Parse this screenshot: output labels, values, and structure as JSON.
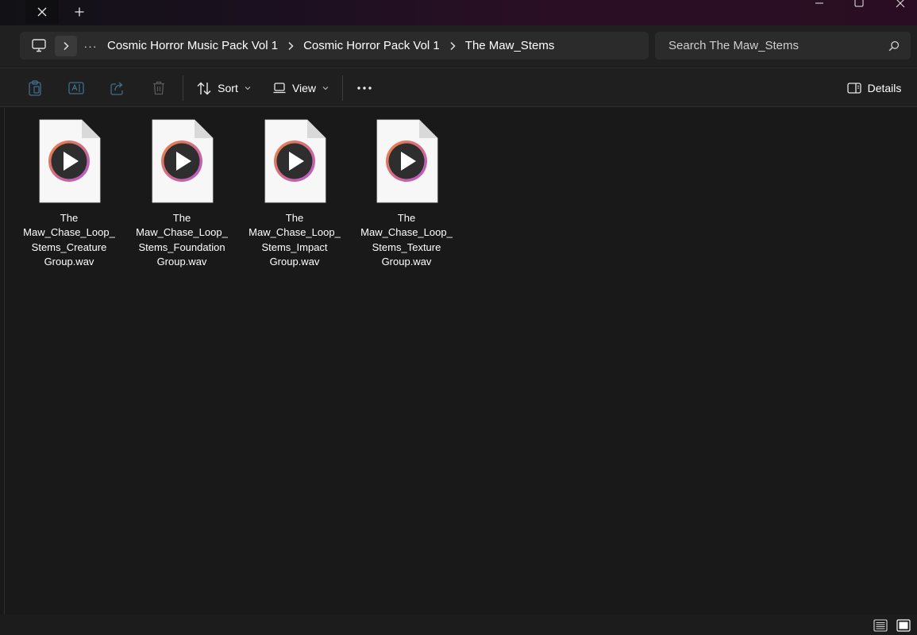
{
  "window": {
    "tab_close_glyph": "✕",
    "new_tab_glyph": "+"
  },
  "breadcrumb": {
    "more_glyph": "···",
    "items": [
      {
        "label": "Cosmic Horror Music Pack Vol 1"
      },
      {
        "label": "Cosmic Horror Pack Vol 1"
      },
      {
        "label": "The Maw_Stems"
      }
    ]
  },
  "search": {
    "placeholder": "Search The Maw_Stems"
  },
  "toolbar": {
    "sort_label": "Sort",
    "view_label": "View",
    "details_label": "Details"
  },
  "files": [
    {
      "name_lines": [
        "The",
        "Maw_Chase_Loop_",
        "Stems_Creature",
        "Group.wav"
      ]
    },
    {
      "name_lines": [
        "The",
        "Maw_Chase_Loop_",
        "Stems_Foundation",
        "Group.wav"
      ]
    },
    {
      "name_lines": [
        "The",
        "Maw_Chase_Loop_",
        "Stems_Impact",
        "Group.wav"
      ]
    },
    {
      "name_lines": [
        "The",
        "Maw_Chase_Loop_",
        "Stems_Texture",
        "Group.wav"
      ]
    }
  ],
  "icons": {
    "file": "media-player-audio-file-icon",
    "toolbar": [
      "paste-icon",
      "rename-icon",
      "share-icon",
      "delete-icon",
      "sort-icon",
      "view-icon",
      "more-icon",
      "details-pane-icon"
    ]
  },
  "colors": {
    "background": "#191919",
    "toolbar": "#1f1f1f",
    "address_bar": "#2b2b2b",
    "play_ring_start": "#f0833a",
    "play_ring_end": "#b357d6"
  }
}
